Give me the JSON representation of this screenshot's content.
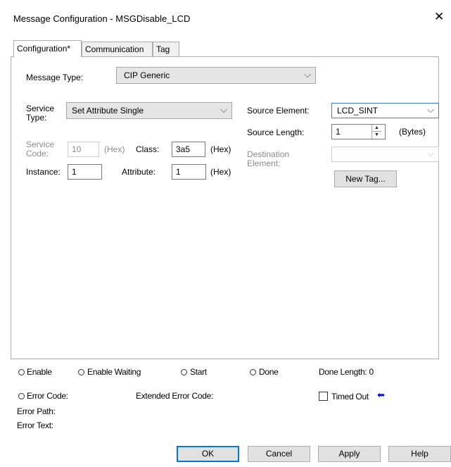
{
  "window": {
    "title": "Message Configuration - MSGDisable_LCD",
    "close_glyph": "✕"
  },
  "tabs": [
    {
      "label": "Configuration*",
      "active": true
    },
    {
      "label": "Communication",
      "active": false
    },
    {
      "label": "Tag",
      "active": false
    }
  ],
  "config": {
    "message_type_label": "Message Type:",
    "message_type_value": "CIP Generic",
    "service_type_label_1": "Service",
    "service_type_label_2": "Type:",
    "service_type_value": "Set Attribute Single",
    "service_code_label_1": "Service",
    "service_code_label_2": "Code:",
    "service_code_value": "10",
    "service_code_unit": "(Hex)",
    "class_label": "Class:",
    "class_value": "3a5",
    "class_unit": "(Hex)",
    "instance_label": "Instance:",
    "instance_value": "1",
    "attribute_label": "Attribute:",
    "attribute_value": "1",
    "attribute_unit": "(Hex)",
    "source_element_label": "Source Element:",
    "source_element_value": "LCD_SINT",
    "source_length_label": "Source Length:",
    "source_length_value": "1",
    "source_length_unit": "(Bytes)",
    "destination_label_1": "Destination",
    "destination_label_2": "Element:",
    "destination_value": "",
    "new_tag_button": "New Tag..."
  },
  "status": {
    "enable": "Enable",
    "enable_waiting": "Enable Waiting",
    "start": "Start",
    "done": "Done",
    "done_length": "Done Length: 0",
    "error_code": "Error Code:",
    "extended_error_code": "Extended Error Code:",
    "timed_out": "Timed Out",
    "timed_out_arrow": "⬅",
    "error_path": "Error Path:",
    "error_text": "Error Text:"
  },
  "buttons": {
    "ok": "OK",
    "cancel": "Cancel",
    "apply": "Apply",
    "help": "Help"
  },
  "colors": {
    "accent": "#0078d7",
    "arrow": "#0000ff"
  }
}
